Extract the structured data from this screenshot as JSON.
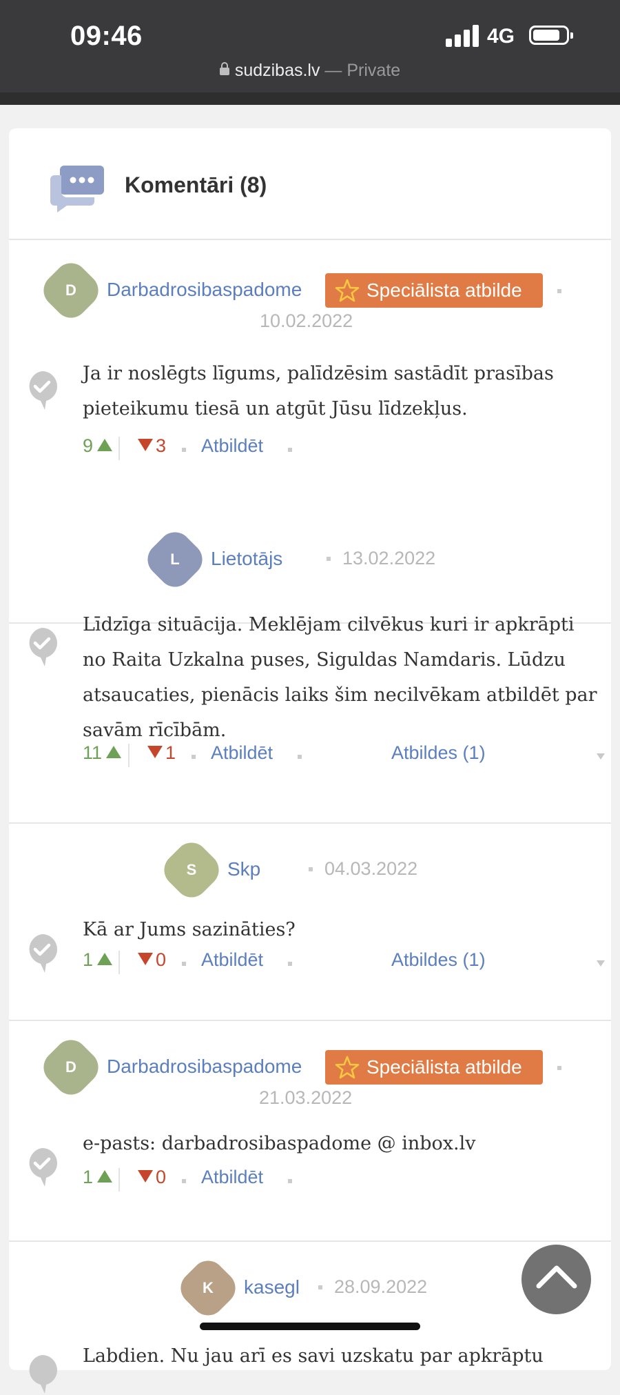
{
  "status_bar": {
    "time": "09:46",
    "network": "4G"
  },
  "browser": {
    "domain": "sudzibas.lv",
    "mode": " — Private"
  },
  "comments_section": {
    "title": "Komentāri (8)"
  },
  "labels": {
    "reply": "Atbildēt",
    "specialist_badge": "Speciālista atbilde"
  },
  "comments": [
    {
      "avatar_letter": "D",
      "author": "Darbadrosibaspadome",
      "specialist": true,
      "date": "10.02.2022",
      "text": "Ja ir noslēgts līgums, palīdzēsim sastādīt prasības pieteikumu tiesā un atgūt Jūsu līdzekļus.",
      "votes_up": "9",
      "votes_down": "3",
      "replies": ""
    },
    {
      "avatar_letter": "L",
      "author": "Lietotājs",
      "specialist": false,
      "date": "13.02.2022",
      "text": "Līdzīga situācija. Meklējam cilvēkus kuri ir apkrāpti no Raita Uzkalna puses, Siguldas Namdaris. Lūdzu atsaucaties, pienācis laiks šim necilvēkam atbildēt par savām rīcībām.",
      "votes_up": "11",
      "votes_down": "1",
      "replies": "Atbildes (1)"
    },
    {
      "avatar_letter": "S",
      "author": "Skp",
      "specialist": false,
      "date": "04.03.2022",
      "text": "Kā ar Jums sazināties?",
      "votes_up": "1",
      "votes_down": "0",
      "replies": "Atbildes (1)"
    },
    {
      "avatar_letter": "D",
      "author": "Darbadrosibaspadome",
      "specialist": true,
      "date": "21.03.2022",
      "text": "e-pasts: darbadrosibaspadome @ inbox.lv",
      "votes_up": "1",
      "votes_down": "0",
      "replies": ""
    },
    {
      "avatar_letter": "K",
      "author": "kasegl",
      "specialist": false,
      "date": "28.09.2022",
      "text": "Labdien. Nu jau arī es savi uzskatu par apkrāptu",
      "votes_up": "",
      "votes_down": "",
      "replies": ""
    }
  ],
  "colors": {
    "avatar_d": "#a9b48d",
    "avatar_l": "#8e98b8",
    "avatar_s": "#b3bb8c",
    "avatar_k": "#b8a186",
    "link": "#5b7fbe",
    "badge": "#e07b45",
    "vote_up": "#6ea155",
    "vote_down": "#c6462b"
  },
  "icons": [
    "chat-bubbles-icon",
    "star-icon",
    "check-bubble-icon",
    "arrow-up-icon",
    "arrow-down-icon",
    "lock-icon",
    "chevron-up-icon"
  ]
}
